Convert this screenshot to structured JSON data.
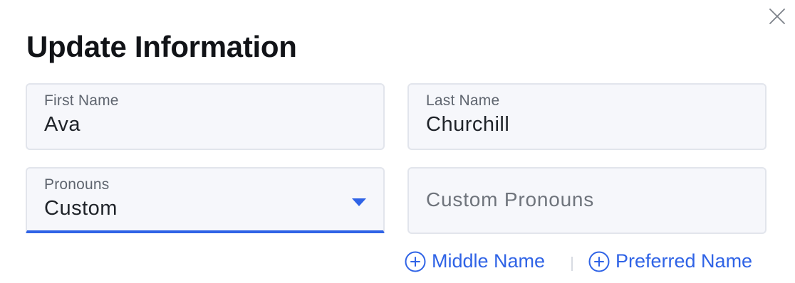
{
  "dialog": {
    "title": "Update Information",
    "close_icon": "close-icon"
  },
  "fields": {
    "first_name": {
      "label": "First Name",
      "value": "Ava"
    },
    "last_name": {
      "label": "Last Name",
      "value": "Churchill"
    },
    "pronouns": {
      "label": "Pronouns",
      "value": "Custom",
      "icon": "chevron-down-icon"
    },
    "custom_pronouns": {
      "placeholder": "Custom Pronouns",
      "value": ""
    }
  },
  "links": {
    "middle_name": {
      "label": "Middle Name",
      "icon": "plus-circle-icon"
    },
    "preferred_name": {
      "label": "Preferred Name",
      "icon": "plus-circle-icon"
    }
  },
  "colors": {
    "accent": "#2f63e6",
    "field_background": "#f6f7fb",
    "field_border": "#e2e5ec"
  }
}
